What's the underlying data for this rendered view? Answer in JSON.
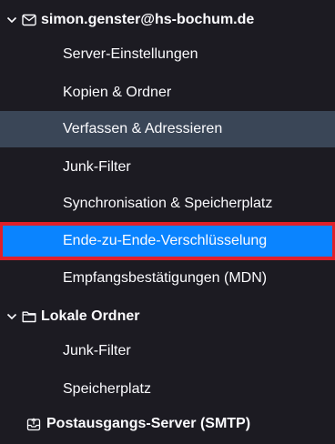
{
  "accounts": [
    {
      "name": "simon.genster@hs-bochum.de",
      "icon": "mail-icon",
      "expanded": true,
      "items": [
        {
          "label": "Server-Einstellungen"
        },
        {
          "label": "Kopien & Ordner"
        },
        {
          "label": "Verfassen & Adressieren",
          "state": "hover"
        },
        {
          "label": "Junk-Filter"
        },
        {
          "label": "Synchronisation & Speicherplatz"
        },
        {
          "label": "Ende-zu-Ende-Verschlüsselung",
          "state": "selected"
        },
        {
          "label": "Empfangsbestätigungen (MDN)"
        }
      ]
    },
    {
      "name": "Lokale Ordner",
      "icon": "folder-icon",
      "expanded": true,
      "items": [
        {
          "label": "Junk-Filter"
        },
        {
          "label": "Speicherplatz"
        }
      ]
    }
  ],
  "smtp": {
    "label": "Postausgangs-Server (SMTP)",
    "icon": "outgoing-server-icon"
  },
  "colors": {
    "background": "#1c1b22",
    "hover": "#3a4657",
    "selected": "#0a84ff",
    "highlight_outline": "#e0202a",
    "text": "#fbfbfe"
  }
}
